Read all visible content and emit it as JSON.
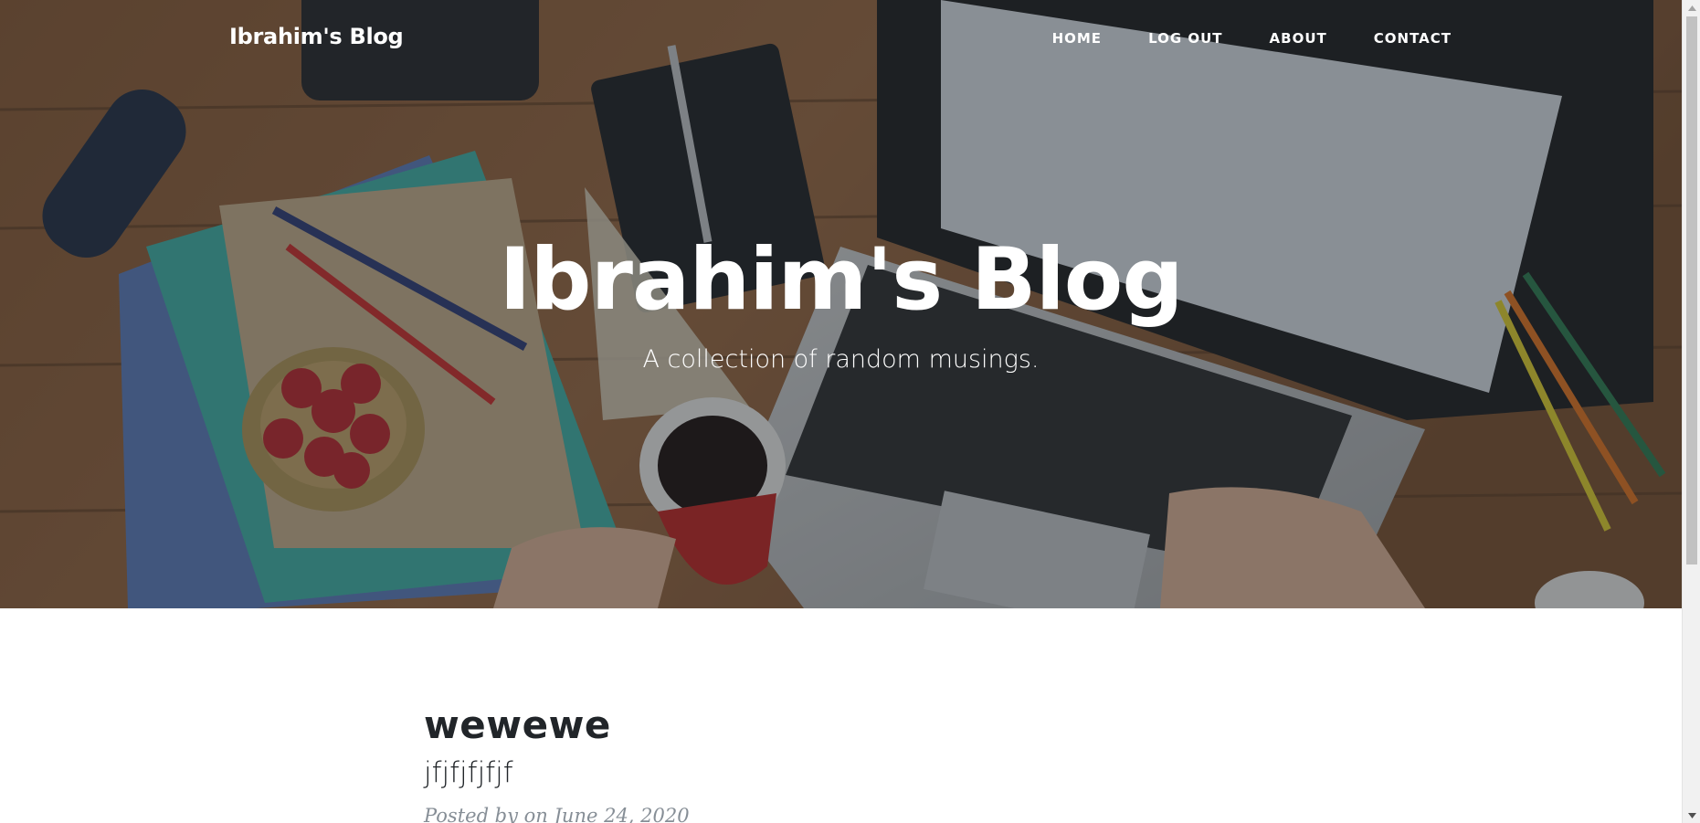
{
  "navbar": {
    "brand": "Ibrahim's Blog",
    "links": [
      {
        "label": "Home"
      },
      {
        "label": "Log Out"
      },
      {
        "label": "About"
      },
      {
        "label": "Contact"
      }
    ]
  },
  "hero": {
    "title": "Ibrahim's Blog",
    "subtitle": "A collection of random musings."
  },
  "posts": [
    {
      "title": "wewewe",
      "subtitle": "jfjfjfjfjf",
      "meta": "Posted by on June 24, 2020"
    }
  ],
  "colors": {
    "heading_text": "#212529",
    "meta_text": "#868e96",
    "hero_overlay": "rgba(33,37,41,0.45)"
  },
  "icons": {
    "scroll_up": "triangle-up-icon",
    "scroll_down": "triangle-down-icon"
  }
}
